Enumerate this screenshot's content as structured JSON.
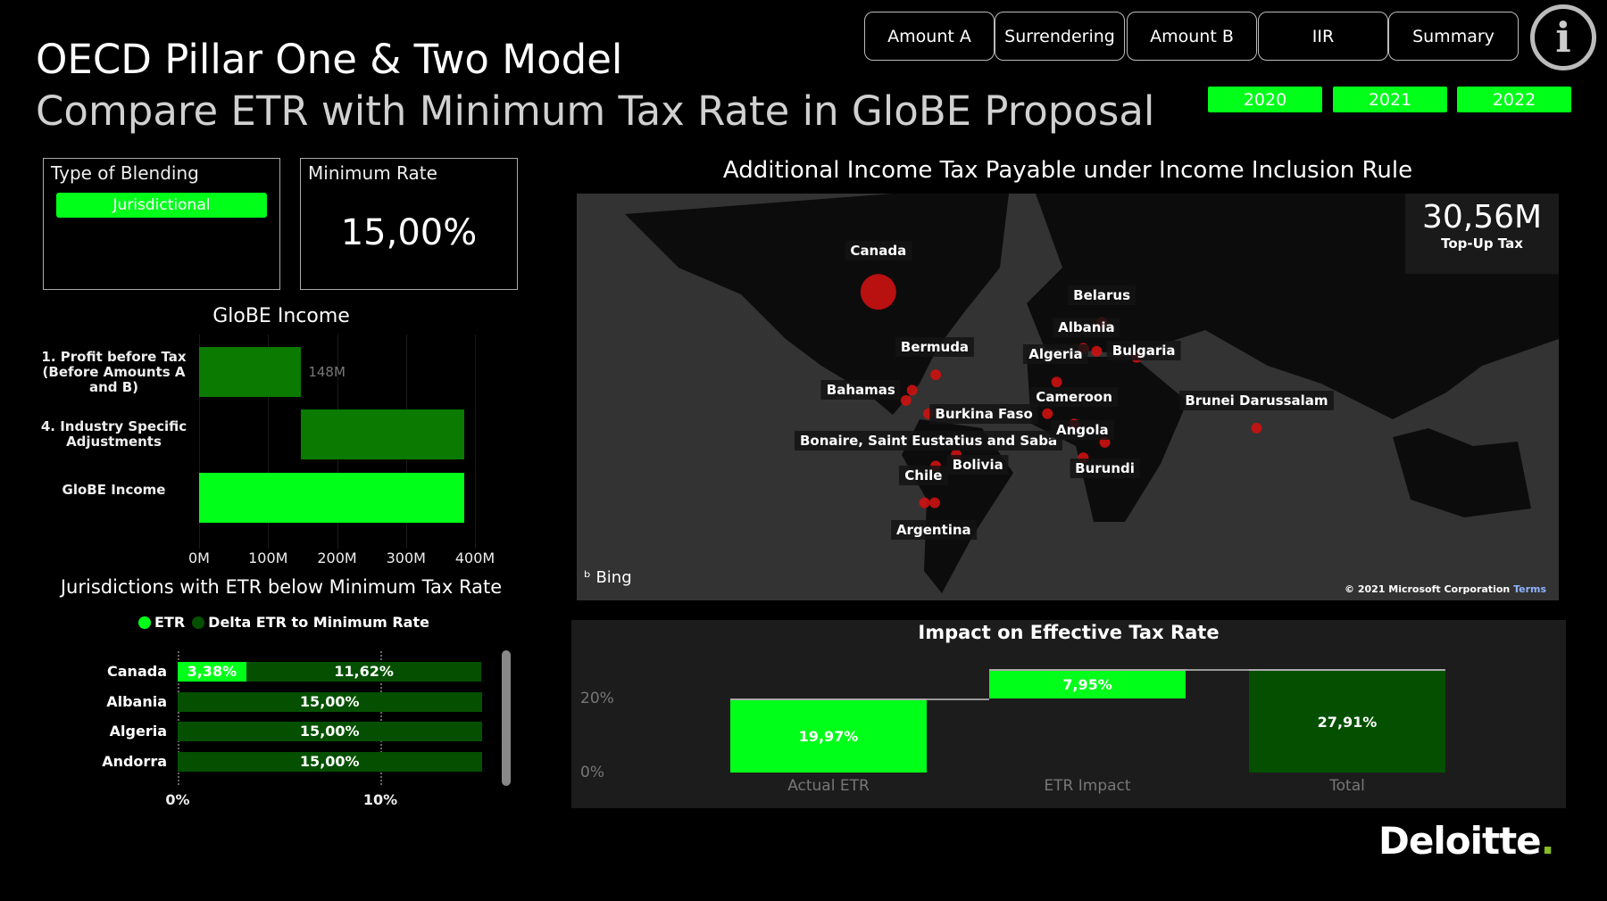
{
  "header": {
    "title": "OECD Pillar One & Two Model",
    "subtitle": "Compare ETR with Minimum Tax Rate in GloBE Proposal"
  },
  "nav": [
    "Amount A",
    "Surrendering",
    "Amount B",
    "IIR",
    "Summary"
  ],
  "info_icon": "info-icon",
  "years": [
    "2020",
    "2021",
    "2022"
  ],
  "colors": {
    "accent": "#00ff19",
    "dark_green": "#0a7a00",
    "delta_green": "#045000",
    "background": "#000000",
    "dot": "#cc1111"
  },
  "blending": {
    "label": "Type of Blending",
    "value": "Jurisdictional"
  },
  "min_rate": {
    "label": "Minimum Rate",
    "value": "15,00%"
  },
  "chart_data": [
    {
      "type": "bar",
      "title": "GloBE Income",
      "orientation": "horizontal-waterfall",
      "categories": [
        "1. Profit before Tax (Before Amounts A and B)",
        "4. Industry Specific Adjustments",
        "GloBE Income"
      ],
      "values": [
        148,
        237,
        385
      ],
      "data_labels": [
        "148M",
        "",
        ""
      ],
      "xticks": [
        "0M",
        "100M",
        "200M",
        "300M",
        "400M"
      ],
      "xlim": [
        0,
        400
      ]
    },
    {
      "type": "bar",
      "title": "Jurisdictions with ETR below Minimum Tax Rate",
      "orientation": "horizontal-stacked",
      "categories": [
        "Canada",
        "Albania",
        "Algeria",
        "Andorra"
      ],
      "series": [
        {
          "name": "ETR",
          "values": [
            3.38,
            0,
            0,
            0
          ],
          "labels": [
            "3,38%",
            "",
            "",
            ""
          ]
        },
        {
          "name": "Delta ETR to Minimum Rate",
          "values": [
            11.62,
            15,
            15,
            15
          ],
          "labels": [
            "11,62%",
            "15,00%",
            "15,00%",
            "15,00%"
          ]
        }
      ],
      "xticks": [
        "0%",
        "10%"
      ],
      "xlim": [
        0,
        15
      ]
    },
    {
      "type": "bar",
      "title": "Impact on Effective Tax Rate",
      "orientation": "waterfall",
      "categories": [
        "Actual ETR",
        "ETR Impact",
        "Total"
      ],
      "values": [
        19.97,
        7.95,
        27.91
      ],
      "labels": [
        "19,97%",
        "7,95%",
        "27,91%"
      ],
      "yticks": [
        "0%",
        "20%"
      ],
      "ylim": [
        0,
        30
      ]
    }
  ],
  "map": {
    "title": "Additional Income Tax Payable under Income Inclusion Rule",
    "kpi_value": "30,56M",
    "kpi_label": "Top-Up Tax",
    "brand": "Bing",
    "copyright": "© 2021 Microsoft Corporation",
    "terms": "Terms",
    "labels": [
      "Canada",
      "Belarus",
      "Albania",
      "Algeria",
      "Bulgaria",
      "Bermuda",
      "Bahamas",
      "Burkina Faso",
      "Cameroon",
      "Brunei Darussalam",
      "Bonaire, Saint Eustatius and Saba",
      "Angola",
      "Bolivia",
      "Chile",
      "Burundi",
      "Argentina"
    ]
  },
  "footer": {
    "logo": "Deloitte"
  }
}
